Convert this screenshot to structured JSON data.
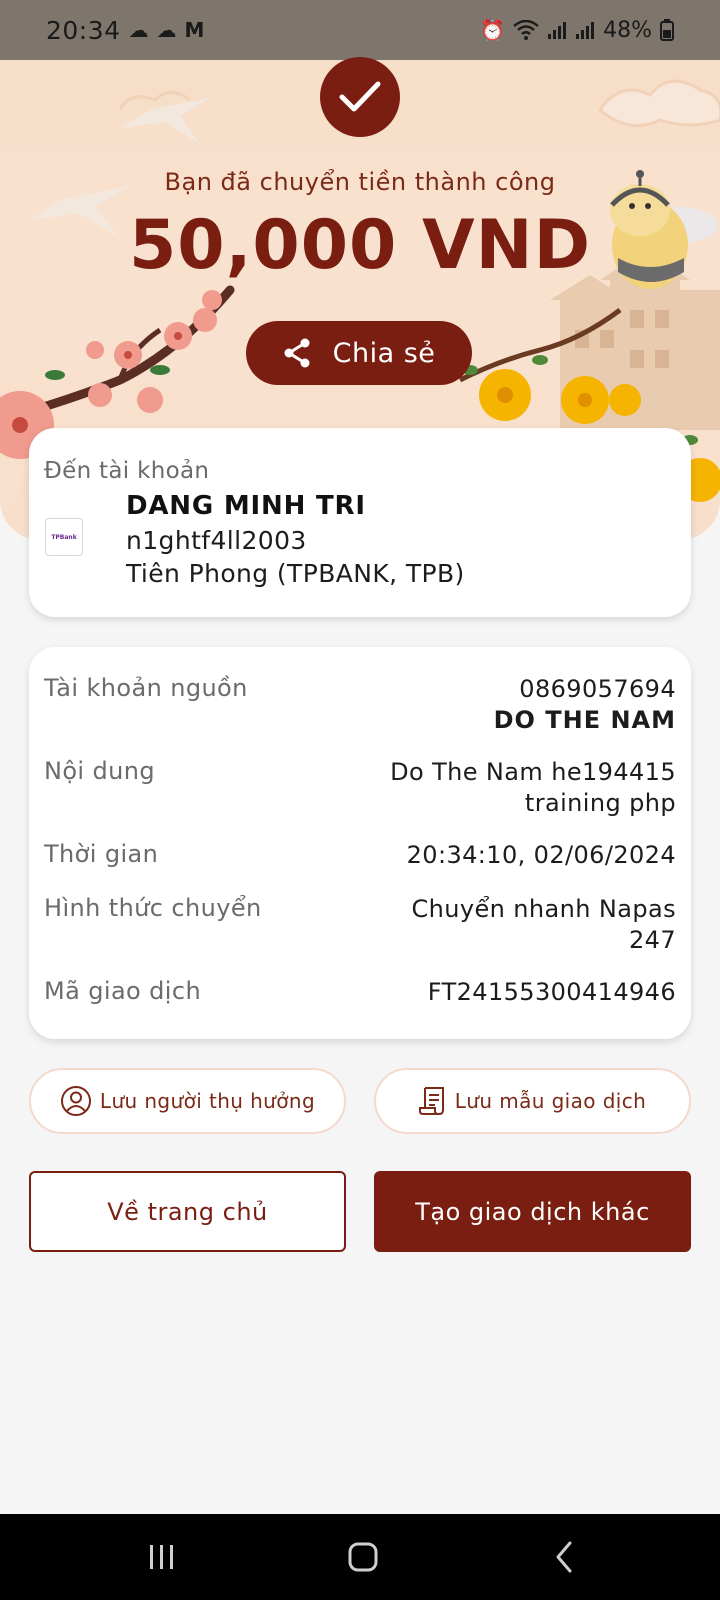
{
  "status_bar": {
    "time": "20:34",
    "battery": "48%",
    "left_icons": [
      "weather-cloud-moon-icon",
      "cloud-icon",
      "gmail-icon"
    ],
    "right_icons": [
      "alarm-icon",
      "wifi-icon",
      "signal-icon",
      "signal-icon",
      "battery-icon"
    ]
  },
  "hero": {
    "success_message": "Bạn đã chuyển tiền thành công",
    "amount": "50,000 VND",
    "share_label": "Chia sẻ"
  },
  "destination": {
    "label": "Đến tài khoản",
    "bank_logo_text": "TPBank",
    "name": "DANG MINH TRI",
    "account": "n1ghtf4ll2003",
    "bank": "Tiên Phong (TPBANK, TPB)"
  },
  "details": {
    "source_label": "Tài khoản nguồn",
    "source_account": "0869057694",
    "source_name": "DO THE NAM",
    "content_label": "Nội dung",
    "content_line1": "Do The Nam he194415",
    "content_line2": "training php",
    "time_label": "Thời gian",
    "time_value": "20:34:10, 02/06/2024",
    "method_label": "Hình thức chuyển",
    "method_line1": "Chuyển nhanh Napas",
    "method_line2": "247",
    "txn_label": "Mã giao dịch",
    "txn_value": "FT24155300414946"
  },
  "actions": {
    "save_beneficiary": "Lưu người thụ hưởng",
    "save_template": "Lưu mẫu giao dịch",
    "home": "Về trang chủ",
    "new_transaction": "Tạo giao dịch khác"
  },
  "colors": {
    "brand": "#7b1e12",
    "hero_bg": "#f6dcc5",
    "page_bg": "#f5f5f5"
  }
}
